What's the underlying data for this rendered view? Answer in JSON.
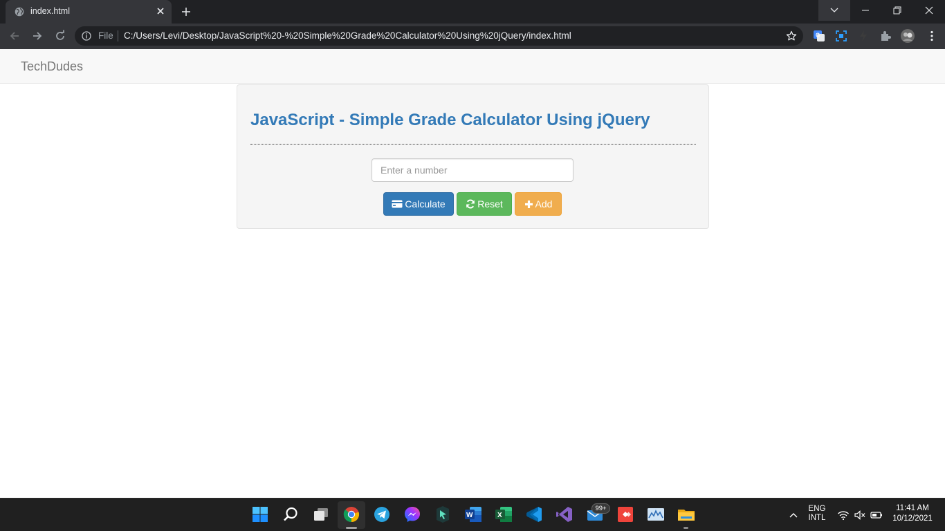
{
  "browser": {
    "tab_title": "index.html",
    "omnibox_scheme_label": "File",
    "url": "C:/Users/Levi/Desktop/JavaScript%20-%20Simple%20Grade%20Calculator%20Using%20jQuery/index.html"
  },
  "navbar": {
    "brand": "TechDudes"
  },
  "panel": {
    "title": "JavaScript - Simple Grade Calculator Using jQuery",
    "input_placeholder": "Enter a number",
    "input_value": "",
    "buttons": {
      "calculate": "Calculate",
      "reset": "Reset",
      "add": "Add"
    }
  },
  "colors": {
    "primary": "#337ab7",
    "success": "#5cb85c",
    "warning": "#f0ad4e",
    "brand_text": "#777777"
  },
  "taskbar": {
    "apps": [
      "start-icon",
      "search-icon",
      "task-view-icon",
      "chrome-icon",
      "telegram-icon",
      "messenger-icon",
      "cursor-app-icon",
      "word-icon",
      "excel-icon",
      "vscode-icon",
      "visual-studio-icon",
      "mail-icon",
      "anydesk-icon",
      "monitor-app-icon",
      "file-explorer-icon"
    ],
    "mail_badge": "99+",
    "language_line1": "ENG",
    "language_line2": "INTL",
    "time": "11:41 AM",
    "date": "10/12/2021"
  }
}
